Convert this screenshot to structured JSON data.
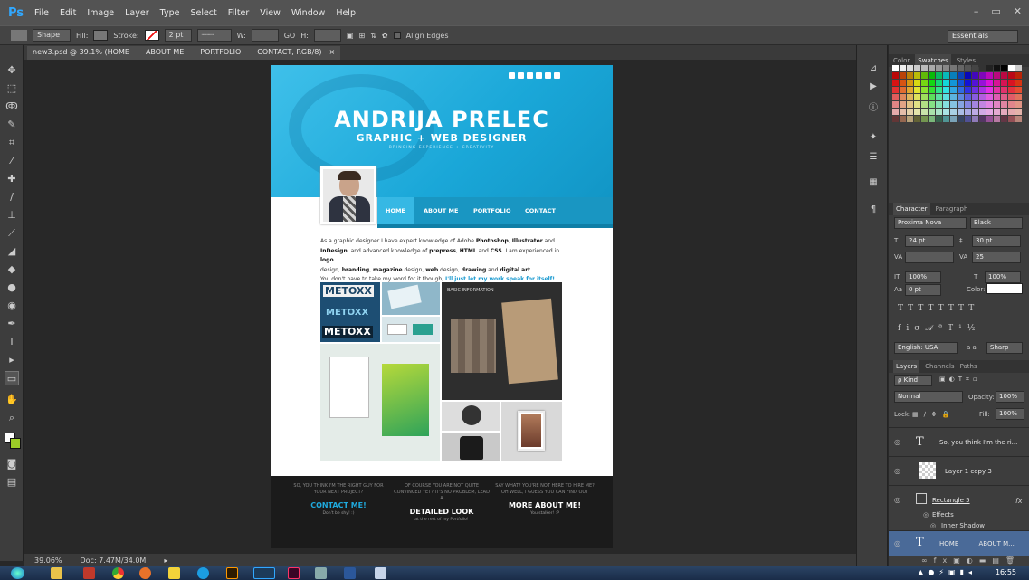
{
  "app": {
    "logo": "Ps",
    "menu": [
      "File",
      "Edit",
      "Image",
      "Layer",
      "Type",
      "Select",
      "Filter",
      "View",
      "Window",
      "Help"
    ],
    "workspace": "Essentials"
  },
  "options": {
    "mode": "Shape",
    "fill": "Fill:",
    "stroke": "Stroke:",
    "stroke_width": "2 pt",
    "w": "W:",
    "go": "GO",
    "h": "H:",
    "align_edges": "Align Edges"
  },
  "document": {
    "tab_title": "new3.psd @ 39.1% (HOME",
    "tab_2": "ABOUT ME",
    "tab_3": "PORTFOLIO",
    "tab_4": "CONTACT, RGB/8)",
    "close": "×"
  },
  "site": {
    "name": "ANDRIJA PRELEC",
    "role": "GRAPHIC + WEB DESIGNER",
    "tagline": "BRINGING EXPERIENCE + CREATIVITY",
    "nav": [
      "HOME",
      "ABOUT ME",
      "PORTFOLIO",
      "CONTACT"
    ],
    "intro": {
      "l1a": "As a graphic designer I have expert knowledge of Adobe ",
      "photoshop": "Photoshop",
      "l1b": ", ",
      "illustrator": "Illustrator",
      "l1c": " and",
      "indesign": "InDesign",
      "l2a": ", and advanced knowledge of ",
      "prepress": "prepress",
      "l2b": ", ",
      "html": "HTML",
      "l2c": " and ",
      "css": "CSS",
      "l2d": ". I am experienced in ",
      "logo": "logo",
      "l3a": "design, ",
      "branding": "branding",
      "l3b": ", ",
      "magazine": "magazine",
      "l3c": " design, ",
      "web": "web",
      "l3d": " design, ",
      "drawing": "drawing",
      "l3e": " and ",
      "digital": "digital art",
      ".": ".",
      "l4a": "You don't have to take my word for it though, ",
      "l4b": "I'll just let my work speak for itself!"
    },
    "portfolio": {
      "metoxx1": "METOXX",
      "metoxx2": "METOXX",
      "metoxx3": "METOXX",
      "mag": "BASIC INFORMATION"
    },
    "footer": [
      {
        "small": "SO, YOU THINK I'M THE RIGHT GUY FOR YOUR NEXT PROJECT?",
        "head": "CONTACT ME!",
        "sub": "Don't be shy! :)"
      },
      {
        "small": "OF COURSE YOU ARE NOT QUITE CONVINCED YET? IT'S NO PROBLEM, LEAD A",
        "head": "DETAILED LOOK",
        "sub": "at the rest of my Portfolio!"
      },
      {
        "small": "SAY WHAT? YOU'RE NOT HERE TO HIRE ME? OH WELL, I GUESS YOU CAN FIND OUT",
        "head": "MORE ABOUT ME!",
        "sub": "You stalker! :P"
      }
    ]
  },
  "status": {
    "zoom": "39.06%",
    "doc": "Doc: 7.47M/34.0M"
  },
  "panels": {
    "color_tabs": [
      "Color",
      "Swatches",
      "Styles"
    ],
    "char_tabs": [
      "Character",
      "Paragraph"
    ],
    "font": "Proxima Nova",
    "style": "Black",
    "size": "24 pt",
    "leading": "30 pt",
    "kerning": "",
    "tracking": "25",
    "vscale": "100%",
    "hscale": "100%",
    "baseline": "0 pt",
    "color_label": "Color:",
    "language": "English: USA",
    "aa": "a a",
    "aa_mode": "Sharp",
    "layer_tabs": [
      "Layers",
      "Channels",
      "Paths"
    ],
    "kind": "ρ Kind",
    "blend": "Normal",
    "opacity_label": "Opacity:",
    "opacity": "100%",
    "lock": "Lock:",
    "fill_label": "Fill:",
    "fill": "100%",
    "layers": [
      {
        "name": "So, you think  I'm the ri...",
        "kind": "T"
      },
      {
        "name": "Layer 1 copy 3",
        "kind": "img"
      },
      {
        "name": "Rectangle 5",
        "kind": "shape",
        "fx": "fx"
      },
      {
        "name": "Effects",
        "kind": "fx-sub"
      },
      {
        "name": "Inner Shadow",
        "kind": "fx-sub"
      },
      {
        "name": "HOME          ABOUT M...",
        "kind": "T"
      }
    ]
  },
  "taskbar": {
    "time": "16:55"
  }
}
